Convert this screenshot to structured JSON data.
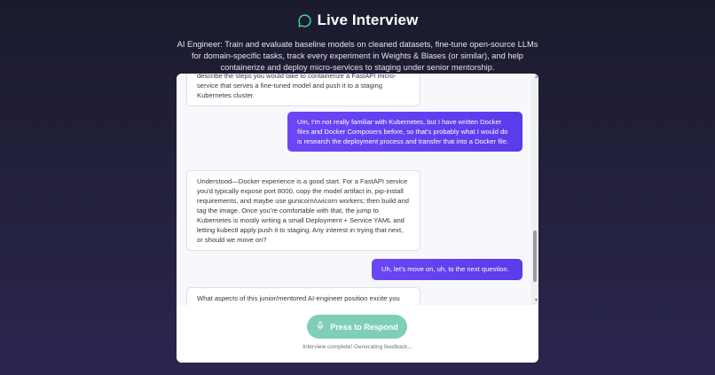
{
  "header": {
    "title": "Live Interview",
    "description": "AI Engineer: Train and evaluate baseline models on cleaned datasets, fine-tune open-source LLMs for domain-specific tasks, track every experiment in Weights & Blases (or similar), and help containerize and deploy micro-services to staging under senior mentorship."
  },
  "chat": {
    "messages": [
      {
        "role": "ai",
        "text": "describe the steps you would take to containerize a FastAPI micro-service that serves a fine-tuned model and push it to a staging Kubernetes cluster."
      },
      {
        "role": "user",
        "text": "Um, I'm not really familiar with Kubernetes, but I have written Docker files and Docker Composers before, so that's probably what I would do is research the deployment process and transfer that into a Docker file."
      },
      {
        "role": "ai",
        "text": "Understood—Docker experience is a good start. For a FastAPI service you'd typically expose port 8000, copy the model artifact in, pip-install requirements, and maybe use gunicorn/uvicorn workers; then build and tag the image. Once you're comfortable with that, the jump to Kubernetes is mostly writing a small Deployment + Service YAML and letting kubectl apply push it to staging. Any interest in trying that next, or should we move on?"
      },
      {
        "role": "user",
        "text": "Uh, let's move on, uh, to the next question."
      },
      {
        "role": "ai",
        "text": "What aspects of this junior/mentored AI-engineer position excite you"
      }
    ]
  },
  "controls": {
    "respond_label": "Press to Respond",
    "status": "Interview complete! Generating feedback..."
  },
  "colors": {
    "background": "#1f1e35",
    "user_bubble": "#6246f2",
    "respond_button": "#7fcfb8"
  },
  "icons": {
    "title": "chat-bubble-icon",
    "respond": "microphone-icon"
  }
}
